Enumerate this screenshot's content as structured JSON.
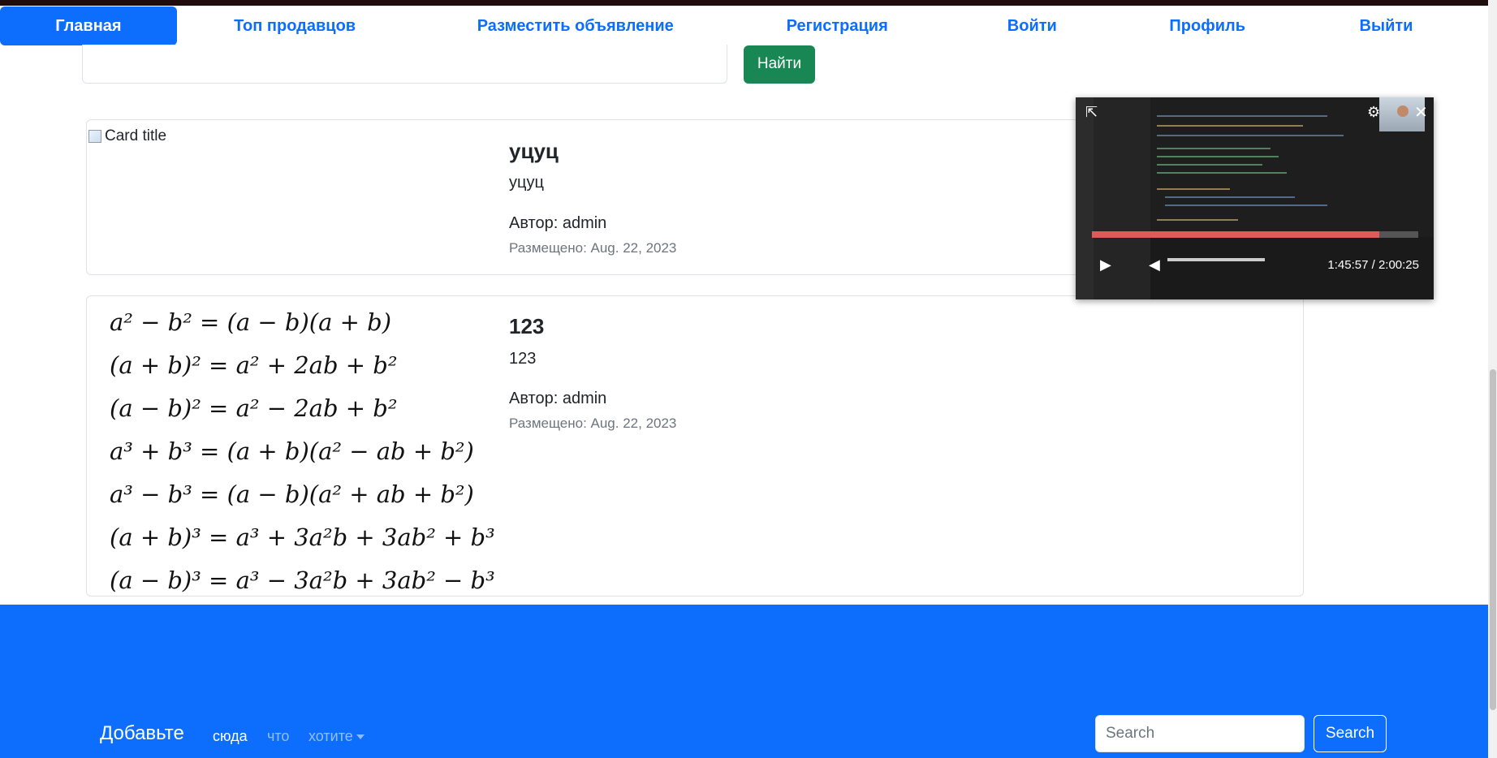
{
  "nav": {
    "items": [
      {
        "label": "Главная",
        "active": true
      },
      {
        "label": "Топ продавцов"
      },
      {
        "label": "Разместить объявление"
      },
      {
        "label": "Регистрация"
      },
      {
        "label": "Войти"
      },
      {
        "label": "Профиль"
      },
      {
        "label": "Выйти"
      }
    ]
  },
  "search": {
    "value": "",
    "button_label": "Найти"
  },
  "cards": [
    {
      "image_alt": "Card title",
      "title": "уцуц",
      "text": "уцуц",
      "author": "Автор: admin",
      "date": "Размещено: Aug. 22, 2023"
    },
    {
      "image_formulas": [
        "a² − b² = (a − b)(a + b)",
        "(a + b)² = a² + 2ab + b²",
        "(a − b)² = a² − 2ab + b²",
        "a³ + b³ = (a + b)(a² − ab + b²)",
        "a³ − b³ = (a − b)(a² + ab + b²)",
        "(a + b)³ = a³ + 3a²b + 3ab² + b³",
        "(a − b)³ = a³ − 3a²b + 3ab² − b³"
      ],
      "title": "123",
      "text": "123",
      "author": "Автор: admin",
      "date": "Размещено: Aug. 22, 2023"
    }
  ],
  "footer": {
    "brand": "Добавьте",
    "links": [
      "сюда",
      "что",
      "хотите"
    ],
    "search_placeholder": "Search",
    "search_button": "Search"
  },
  "pip_player": {
    "time": "1:45:57 / 2:00:25",
    "progress": 0.88,
    "icons": [
      "open-external-icon",
      "settings-icon",
      "close-icon",
      "play-icon",
      "volume-icon"
    ]
  },
  "colors": {
    "primary": "#0d6efd",
    "success": "#198754",
    "muted": "#6c757d"
  }
}
